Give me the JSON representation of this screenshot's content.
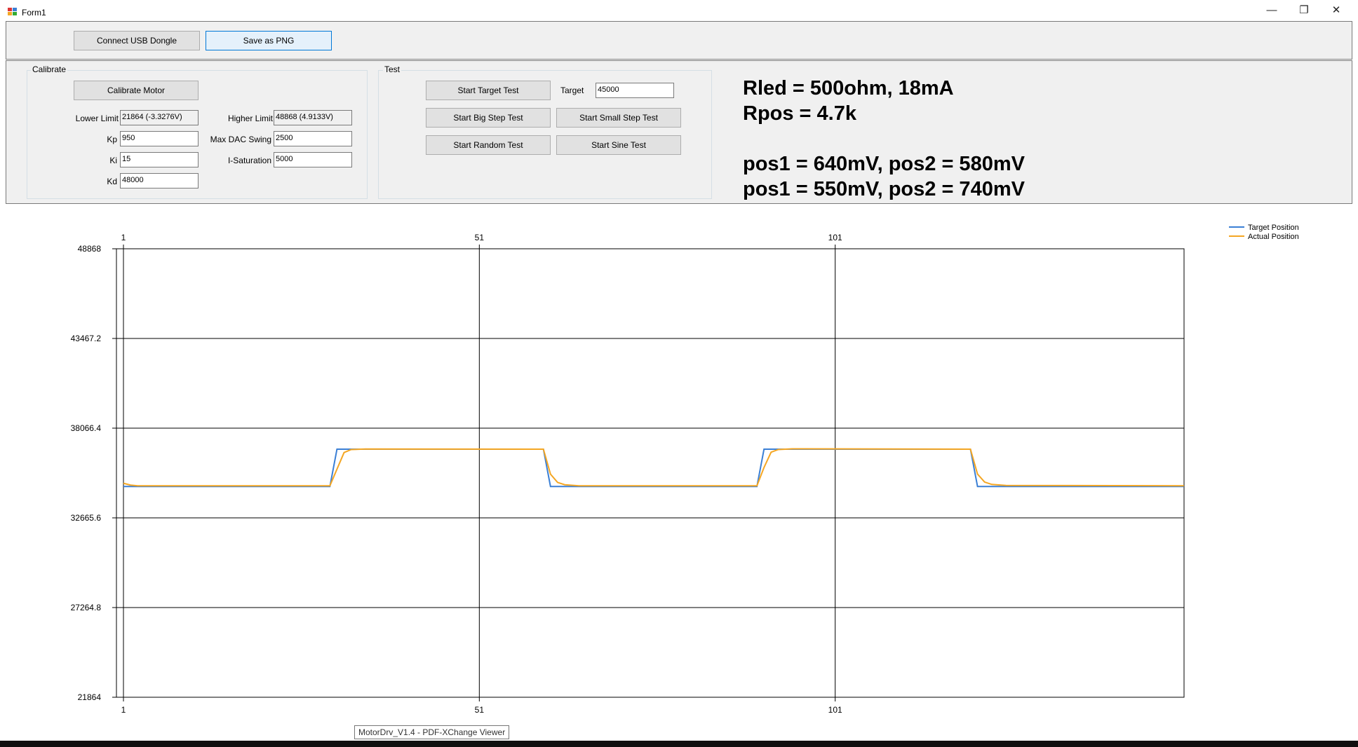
{
  "window": {
    "title": "Form1",
    "minimize": "—",
    "restore": "❐",
    "close": "✕"
  },
  "toolbar": {
    "connect_label": "Connect USB Dongle",
    "save_label": "Save as PNG"
  },
  "calibrate": {
    "group_label": "Calibrate",
    "button_label": "Calibrate Motor",
    "lower_limit_label": "Lower Limit",
    "lower_limit_value": "21864 (-3.3276V)",
    "higher_limit_label": "Higher Limit",
    "higher_limit_value": "48868 (4.9133V)",
    "kp_label": "Kp",
    "kp_value": "950",
    "max_dac_label": "Max DAC Swing",
    "max_dac_value": "2500",
    "ki_label": "Ki",
    "ki_value": "15",
    "isat_label": "I-Saturation",
    "isat_value": "5000",
    "kd_label": "Kd",
    "kd_value": "48000"
  },
  "test": {
    "group_label": "Test",
    "target_test_label": "Start Target Test",
    "target_label": "Target",
    "target_value": "45000",
    "big_step_label": "Start Big Step Test",
    "small_step_label": "Start Small Step Test",
    "random_label": "Start Random Test",
    "sine_label": "Start Sine Test"
  },
  "notes": {
    "line1": "Rled = 500ohm, 18mA",
    "line2": "Rpos = 4.7k",
    "line3": "pos1 = 640mV, pos2 = 580mV",
    "line4": "pos1 = 550mV, pos2 = 740mV"
  },
  "tooltip": "MotorDrv_V1.4 - PDF-XChange Viewer",
  "colors": {
    "target": "#3a7fd5",
    "actual": "#f4a623"
  },
  "chart_data": {
    "type": "line",
    "x_ticks": [
      "1",
      "51",
      "101"
    ],
    "y_ticks": [
      "48868",
      "43467.2",
      "38066.4",
      "32665.6",
      "27264.8",
      "21864"
    ],
    "xlim": [
      1,
      151
    ],
    "ylim": [
      21864,
      48868
    ],
    "legend": "top-right",
    "grid": true,
    "series": [
      {
        "name": "Target Position",
        "x": [
          1,
          30,
          31,
          60,
          61,
          90,
          91,
          120,
          121,
          150
        ],
        "y": [
          34550,
          34550,
          36800,
          36800,
          34550,
          34550,
          36800,
          36800,
          34550,
          34550
        ]
      },
      {
        "name": "Actual Position",
        "x": [
          1,
          2,
          3,
          30,
          31,
          32,
          33,
          35,
          60,
          61,
          62,
          63,
          65,
          90,
          91,
          92,
          93,
          95,
          120,
          121,
          122,
          123,
          125,
          150
        ],
        "y": [
          34750,
          34640,
          34600,
          34600,
          35600,
          36600,
          36780,
          36810,
          36800,
          35300,
          34800,
          34660,
          34600,
          34600,
          35700,
          36620,
          36780,
          36820,
          36800,
          35300,
          34820,
          34680,
          34620,
          34600
        ]
      }
    ]
  }
}
